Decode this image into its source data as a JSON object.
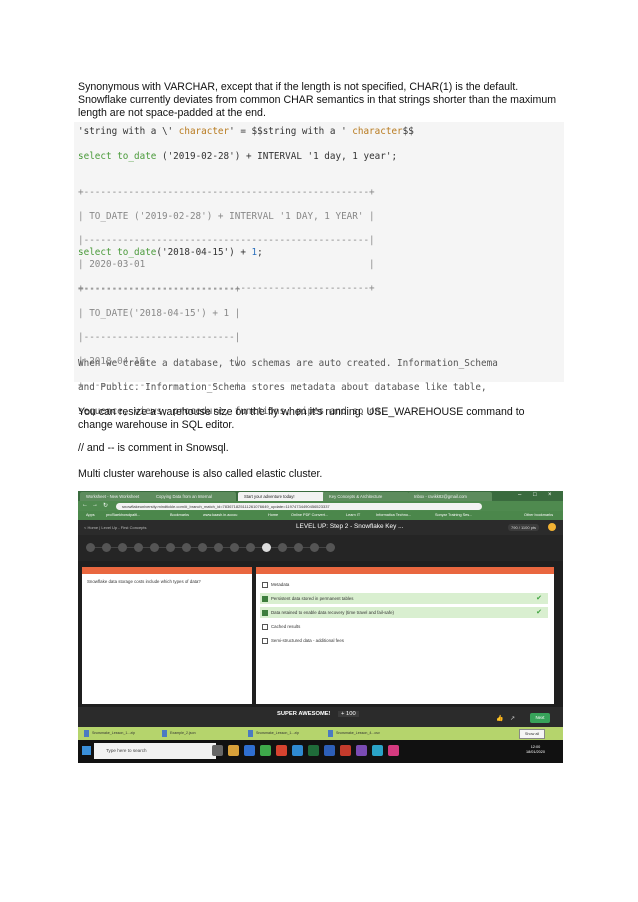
{
  "intro": {
    "line1": "Synonymous with VARCHAR, except that if the length is not specified, CHAR(1) is the default.",
    "line2": "Snowflake currently deviates from common CHAR semantics in that strings shorter than the maximum",
    "line3": "length are not space-padded at the end."
  },
  "code": {
    "str_line_a": "'string with a \\' ",
    "str_line_b": "character",
    "str_line_c": "' = $$string with a ' ",
    "str_line_d": "character",
    "str_line_e": "$$",
    "q1_kw": "select",
    "q1_fn": "to_date",
    "q1_rest": " ('2019-02-28') + INTERVAL '1 day, 1 year';",
    "t1_border": "+---------------------------------------------------+",
    "t1_header": "| TO_DATE ('2019-02-28') + INTERVAL '1 DAY, 1 YEAR' |",
    "t1_sep": "|---------------------------------------------------|",
    "t1_value": "| 2020-03-01                                        |",
    "q2_kw": "select",
    "q2_fn": "to_date",
    "q2_rest": "('2018-04-15') + ",
    "q2_num": "1",
    "q2_end": ";",
    "t2_border": "+---------------------------+",
    "t2_header": "| TO_DATE('2018-04-15') + 1 |",
    "t2_sep": "|---------------------------|",
    "t2_value": "| 2018-04-16                |",
    "note_l1": "When we create a database, two schemas are auto created. Information_Schema",
    "note_l2": "and Public. Information_Schema stores metadata about database like table,",
    "note_l3": "sequence, views, procedure, functions, pipes and so on."
  },
  "notes": {
    "resize_l1": "You can resize a warehouse size on the fly when it’s running. USE_WAREHOUSE command to",
    "resize_l2": "change warehouse in SQL editor.",
    "comment": "// and -- is comment in Snowsql.",
    "multicluster": "Multi cluster warehouse is also called elastic cluster."
  },
  "screenshot": {
    "tabs": [
      "Worksheet - New Worksheet",
      "Copying Data from an Internal",
      "Start your adventure today!",
      "Key Concepts & Architecture",
      "Inbox - ravikk82@gmail.com"
    ],
    "url": "snowflakeuniversity.mindtickle.com/#_branch_match_id=783671825111261076649_update=11974734490456523337",
    "bookmarks": [
      "Apps",
      "prc/Baekhowdpaltl...",
      "Bookmarks",
      "www.kaash.in.accou",
      "Home",
      "Online PDF Convert...",
      "Learn IT",
      "Informatica Techno...",
      "Sonyar Training Ses...",
      "Other bookmarks"
    ],
    "breadcrumb": "< Home  |  Level Up - First Concepts",
    "level_title": "LEVEL UP: Step 2 - Snowflake Key ...",
    "score": "790 / 1100 pts",
    "question": "Snowflake data storage costs include which types of data?",
    "options": [
      {
        "label": "Metadata",
        "checked": false,
        "correct": false
      },
      {
        "label": "Persistent data stored in permanent tables",
        "checked": true,
        "correct": true
      },
      {
        "label": "Data retained to enable data recovery (time travel and fail-safe)",
        "checked": true,
        "correct": true
      },
      {
        "label": "Cached results",
        "checked": false,
        "correct": false
      },
      {
        "label": "Semi-structured data - additional fees",
        "checked": false,
        "correct": false
      }
    ],
    "super_awesome": "SUPER AWESOME!",
    "points": "+ 100",
    "next_label": "Next",
    "downloads": [
      "Snowmake_Lesson_1...zip",
      "Example_2.json",
      "Snowmake_Lesson_1...zip",
      "Snowmake_Lesson_4...csv"
    ],
    "show_all": "Show all",
    "search_placeholder": "Type here to search",
    "clock_time": "12:00",
    "clock_date": "18/01/2020",
    "colors": {
      "accent_green": "#37a35a",
      "question_header": "#e9673f",
      "coin": "#f2b233"
    }
  }
}
